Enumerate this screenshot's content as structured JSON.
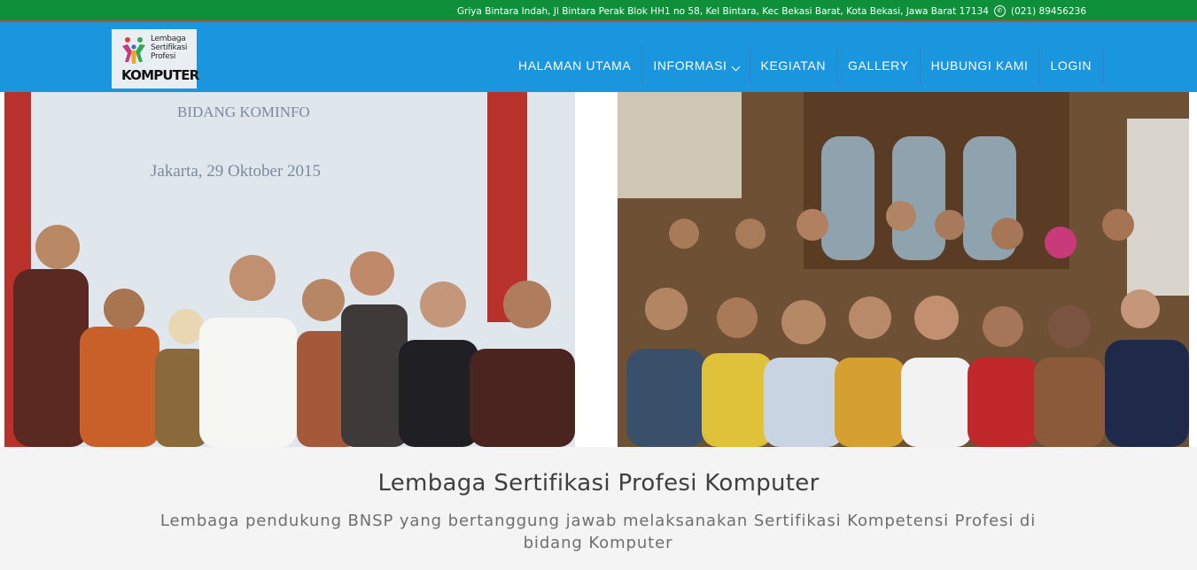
{
  "topbar": {
    "address": "Griya Bintara Indah, Jl Bintara Perak Blok HH1 no 58, Kel Bintara, Kec Bekasi Barat, Kota Bekasi, Jawa Barat 17134",
    "phone": "(021) 89456236",
    "phone_icon": "phone-icon"
  },
  "logo": {
    "line1": "Lembaga",
    "line2": "Sertifikasi",
    "line3": "Profesi",
    "line4": "KOMPUTER"
  },
  "nav": {
    "items": [
      {
        "label": "HALAMAN UTAMA"
      },
      {
        "label": "INFORMASI"
      },
      {
        "label": "KEGIATAN"
      },
      {
        "label": "GALLERY"
      },
      {
        "label": "HUBUNGI KAMI"
      },
      {
        "label": "LOGIN"
      }
    ]
  },
  "hero": {
    "left_photo_text_1": "BIDANG KOMINFO",
    "left_photo_text_2": "Jakarta, 29 Oktober 2015"
  },
  "caption": {
    "title": "Lembaga Sertifikasi Profesi Komputer",
    "description": "Lembaga pendukung BNSP yang bertanggung jawab melaksanakan Sertifikasi Kompetensi Profesi di bidang Komputer"
  },
  "colors": {
    "topbar_bg": "#0f8f3a",
    "topbar_border": "#c8453b",
    "navbar_bg": "#1a96df",
    "caption_bg": "#f4f4f4"
  }
}
